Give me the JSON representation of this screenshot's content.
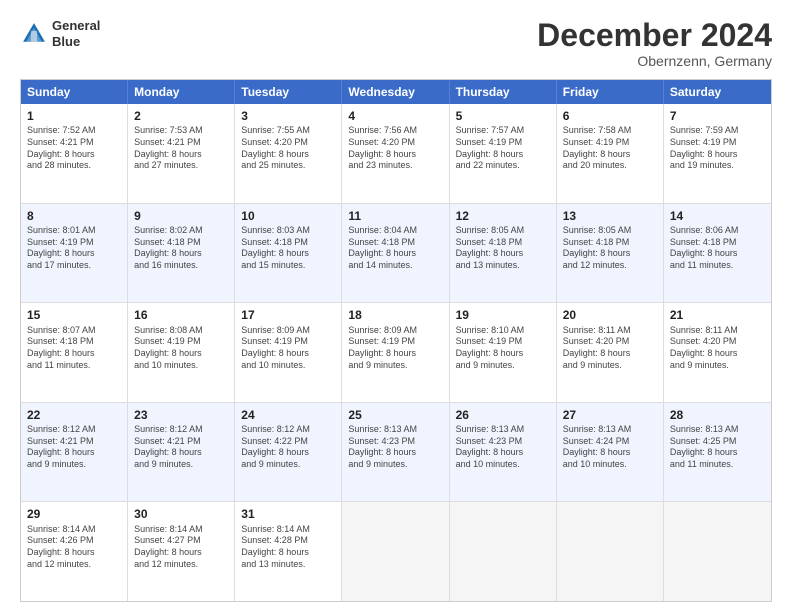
{
  "logo": {
    "line1": "General",
    "line2": "Blue"
  },
  "title": "December 2024",
  "location": "Obernzenn, Germany",
  "header_days": [
    "Sunday",
    "Monday",
    "Tuesday",
    "Wednesday",
    "Thursday",
    "Friday",
    "Saturday"
  ],
  "rows": [
    {
      "alt": false,
      "cells": [
        {
          "day": "1",
          "text": "Sunrise: 7:52 AM\nSunset: 4:21 PM\nDaylight: 8 hours\nand 28 minutes."
        },
        {
          "day": "2",
          "text": "Sunrise: 7:53 AM\nSunset: 4:21 PM\nDaylight: 8 hours\nand 27 minutes."
        },
        {
          "day": "3",
          "text": "Sunrise: 7:55 AM\nSunset: 4:20 PM\nDaylight: 8 hours\nand 25 minutes."
        },
        {
          "day": "4",
          "text": "Sunrise: 7:56 AM\nSunset: 4:20 PM\nDaylight: 8 hours\nand 23 minutes."
        },
        {
          "day": "5",
          "text": "Sunrise: 7:57 AM\nSunset: 4:19 PM\nDaylight: 8 hours\nand 22 minutes."
        },
        {
          "day": "6",
          "text": "Sunrise: 7:58 AM\nSunset: 4:19 PM\nDaylight: 8 hours\nand 20 minutes."
        },
        {
          "day": "7",
          "text": "Sunrise: 7:59 AM\nSunset: 4:19 PM\nDaylight: 8 hours\nand 19 minutes."
        }
      ]
    },
    {
      "alt": true,
      "cells": [
        {
          "day": "8",
          "text": "Sunrise: 8:01 AM\nSunset: 4:19 PM\nDaylight: 8 hours\nand 17 minutes."
        },
        {
          "day": "9",
          "text": "Sunrise: 8:02 AM\nSunset: 4:18 PM\nDaylight: 8 hours\nand 16 minutes."
        },
        {
          "day": "10",
          "text": "Sunrise: 8:03 AM\nSunset: 4:18 PM\nDaylight: 8 hours\nand 15 minutes."
        },
        {
          "day": "11",
          "text": "Sunrise: 8:04 AM\nSunset: 4:18 PM\nDaylight: 8 hours\nand 14 minutes."
        },
        {
          "day": "12",
          "text": "Sunrise: 8:05 AM\nSunset: 4:18 PM\nDaylight: 8 hours\nand 13 minutes."
        },
        {
          "day": "13",
          "text": "Sunrise: 8:05 AM\nSunset: 4:18 PM\nDaylight: 8 hours\nand 12 minutes."
        },
        {
          "day": "14",
          "text": "Sunrise: 8:06 AM\nSunset: 4:18 PM\nDaylight: 8 hours\nand 11 minutes."
        }
      ]
    },
    {
      "alt": false,
      "cells": [
        {
          "day": "15",
          "text": "Sunrise: 8:07 AM\nSunset: 4:18 PM\nDaylight: 8 hours\nand 11 minutes."
        },
        {
          "day": "16",
          "text": "Sunrise: 8:08 AM\nSunset: 4:19 PM\nDaylight: 8 hours\nand 10 minutes."
        },
        {
          "day": "17",
          "text": "Sunrise: 8:09 AM\nSunset: 4:19 PM\nDaylight: 8 hours\nand 10 minutes."
        },
        {
          "day": "18",
          "text": "Sunrise: 8:09 AM\nSunset: 4:19 PM\nDaylight: 8 hours\nand 9 minutes."
        },
        {
          "day": "19",
          "text": "Sunrise: 8:10 AM\nSunset: 4:19 PM\nDaylight: 8 hours\nand 9 minutes."
        },
        {
          "day": "20",
          "text": "Sunrise: 8:11 AM\nSunset: 4:20 PM\nDaylight: 8 hours\nand 9 minutes."
        },
        {
          "day": "21",
          "text": "Sunrise: 8:11 AM\nSunset: 4:20 PM\nDaylight: 8 hours\nand 9 minutes."
        }
      ]
    },
    {
      "alt": true,
      "cells": [
        {
          "day": "22",
          "text": "Sunrise: 8:12 AM\nSunset: 4:21 PM\nDaylight: 8 hours\nand 9 minutes."
        },
        {
          "day": "23",
          "text": "Sunrise: 8:12 AM\nSunset: 4:21 PM\nDaylight: 8 hours\nand 9 minutes."
        },
        {
          "day": "24",
          "text": "Sunrise: 8:12 AM\nSunset: 4:22 PM\nDaylight: 8 hours\nand 9 minutes."
        },
        {
          "day": "25",
          "text": "Sunrise: 8:13 AM\nSunset: 4:23 PM\nDaylight: 8 hours\nand 9 minutes."
        },
        {
          "day": "26",
          "text": "Sunrise: 8:13 AM\nSunset: 4:23 PM\nDaylight: 8 hours\nand 10 minutes."
        },
        {
          "day": "27",
          "text": "Sunrise: 8:13 AM\nSunset: 4:24 PM\nDaylight: 8 hours\nand 10 minutes."
        },
        {
          "day": "28",
          "text": "Sunrise: 8:13 AM\nSunset: 4:25 PM\nDaylight: 8 hours\nand 11 minutes."
        }
      ]
    },
    {
      "alt": false,
      "cells": [
        {
          "day": "29",
          "text": "Sunrise: 8:14 AM\nSunset: 4:26 PM\nDaylight: 8 hours\nand 12 minutes."
        },
        {
          "day": "30",
          "text": "Sunrise: 8:14 AM\nSunset: 4:27 PM\nDaylight: 8 hours\nand 12 minutes."
        },
        {
          "day": "31",
          "text": "Sunrise: 8:14 AM\nSunset: 4:28 PM\nDaylight: 8 hours\nand 13 minutes."
        },
        {
          "day": "",
          "text": "",
          "empty": true
        },
        {
          "day": "",
          "text": "",
          "empty": true
        },
        {
          "day": "",
          "text": "",
          "empty": true
        },
        {
          "day": "",
          "text": "",
          "empty": true
        }
      ]
    }
  ]
}
